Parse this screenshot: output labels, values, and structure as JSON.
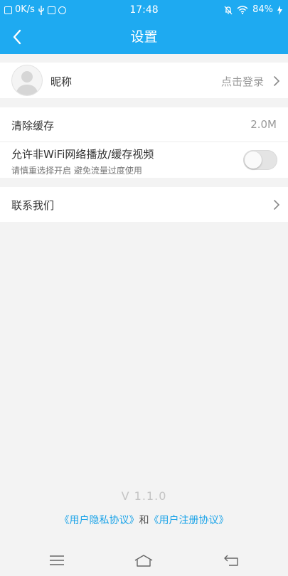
{
  "status_bar": {
    "net_speed": "0K/s",
    "time": "17:48",
    "battery": "84%"
  },
  "header": {
    "title": "设置"
  },
  "profile": {
    "nickname_label": "昵称",
    "login_prompt": "点击登录"
  },
  "settings": {
    "clear_cache_label": "清除缓存",
    "cache_size": "2.0M",
    "wifi_label": "允许非WiFi网络播放/缓存视频",
    "wifi_hint": "请慎重选择开启 避免流量过度使用",
    "wifi_enabled": false,
    "contact_label": "联系我们"
  },
  "footer": {
    "version": "V 1.1.0",
    "privacy_link": "《用户隐私协议》",
    "conjunction": "和",
    "register_link": "《用户注册协议》"
  },
  "colors": {
    "accent": "#1eaaf1",
    "link": "#1aa3e8"
  },
  "icons": {
    "back": "chevron-left-icon",
    "menu": "menu-icon",
    "home": "home-icon",
    "return": "return-icon"
  }
}
